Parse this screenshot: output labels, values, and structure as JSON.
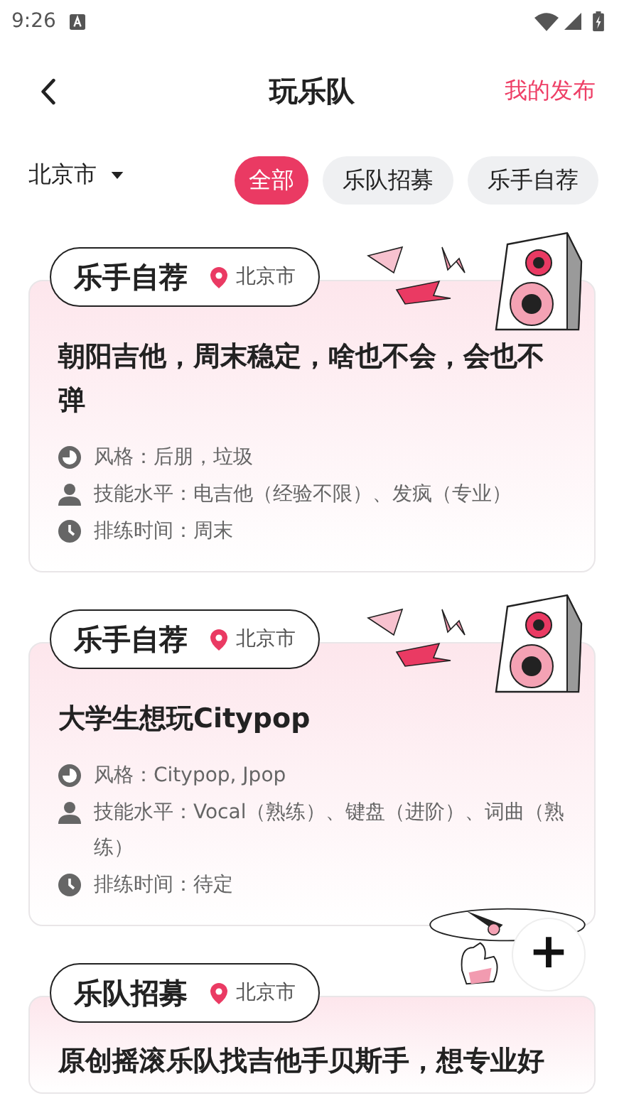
{
  "status_bar": {
    "time": "9:26"
  },
  "header": {
    "title": "玩乐队",
    "action": "我的发布"
  },
  "city": "北京市",
  "filters": [
    {
      "label": "全部",
      "selected": true
    },
    {
      "label": "乐队招募",
      "selected": false
    },
    {
      "label": "乐手自荐",
      "selected": false
    }
  ],
  "posts": [
    {
      "kind": "musician",
      "type": "乐手自荐",
      "location": "北京市",
      "title": "朝阳吉他，周末稳定，啥也不会，会也不弹",
      "details": [
        {
          "kind": "style",
          "text": "风格：后朋，垃圾"
        },
        {
          "kind": "skill",
          "text": "技能水平：电吉他（经验不限）、发疯（专业）"
        },
        {
          "kind": "time",
          "text": "排练时间：周末"
        }
      ]
    },
    {
      "kind": "musician",
      "type": "乐手自荐",
      "location": "北京市",
      "title": "大学生想玩Citypop",
      "details": [
        {
          "kind": "style",
          "text": "风格：Citypop, Jpop"
        },
        {
          "kind": "skill",
          "text": "技能水平：Vocal（熟练）、键盘（进阶）、词曲（熟练）"
        },
        {
          "kind": "time",
          "text": "排练时间：待定"
        }
      ]
    },
    {
      "kind": "band",
      "type": "乐队招募",
      "location": "北京市",
      "title": "原创摇滚乐队找吉他手贝斯手，想专业好"
    }
  ],
  "fab": {
    "label": "+"
  }
}
